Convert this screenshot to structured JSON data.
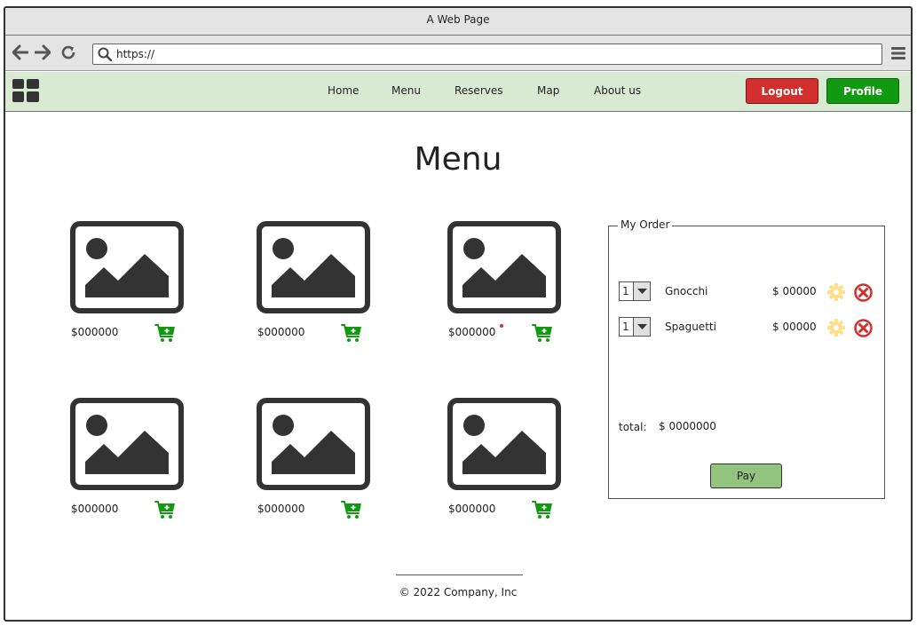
{
  "window": {
    "title": "A Web Page"
  },
  "browser": {
    "url": "https://"
  },
  "navbar": {
    "links": [
      "Home",
      "Menu",
      "Reserves",
      "Map",
      "About us"
    ],
    "logout_label": "Logout",
    "profile_label": "Profile"
  },
  "page": {
    "title": "Menu"
  },
  "products": [
    {
      "price": "$000000"
    },
    {
      "price": "$000000"
    },
    {
      "price": "$000000"
    },
    {
      "price": "$000000"
    },
    {
      "price": "$000000"
    },
    {
      "price": "$000000"
    }
  ],
  "order": {
    "legend": "My Order",
    "items": [
      {
        "qty": "1",
        "name": "Gnocchi",
        "price": "$ 00000"
      },
      {
        "qty": "1",
        "name": "Spaguetti",
        "price": "$ 00000"
      }
    ],
    "total_label": "total:",
    "total_value": "$ 0000000",
    "pay_label": "Pay"
  },
  "footer": {
    "text": "© 2022 Company, Inc"
  },
  "colors": {
    "navbar_bg": "#d9ead3",
    "logout": "#d32f2f",
    "profile": "#119a11",
    "cart": "#119a11",
    "pay": "#93c47d",
    "gear": "#ffe08a",
    "remove": "#d32f2f"
  },
  "icons": [
    "back-arrow-icon",
    "forward-arrow-icon",
    "reload-icon",
    "search-icon",
    "hamburger-menu-icon",
    "app-grid-icon",
    "image-placeholder-icon",
    "add-to-cart-icon",
    "gear-icon",
    "remove-icon",
    "dropdown-arrow-icon"
  ]
}
